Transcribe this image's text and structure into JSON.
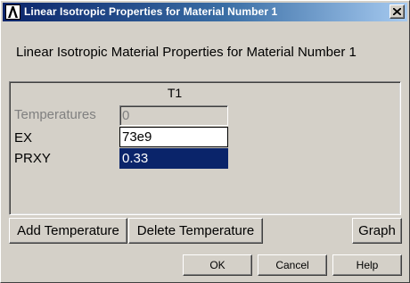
{
  "window": {
    "title": "Linear Isotropic Properties for Material Number 1",
    "app_icon": "ansys-logo-icon",
    "close_icon": "close-icon"
  },
  "heading": "Linear Isotropic Material Properties for Material Number 1",
  "table": {
    "column_header": "T1",
    "rows": [
      {
        "label": "Temperatures",
        "value": "0",
        "state": "disabled"
      },
      {
        "label": "EX",
        "value": "73e9",
        "state": "normal"
      },
      {
        "label": "PRXY",
        "value": "0.33",
        "state": "selected"
      }
    ]
  },
  "buttons": {
    "add_temperature": "Add Temperature",
    "delete_temperature": "Delete Temperature",
    "graph": "Graph",
    "ok": "OK",
    "cancel": "Cancel",
    "help": "Help"
  },
  "colors": {
    "dialog_bg": "#d4d0c8",
    "title_bar": "#0a246a",
    "selection": "#0a246a"
  }
}
